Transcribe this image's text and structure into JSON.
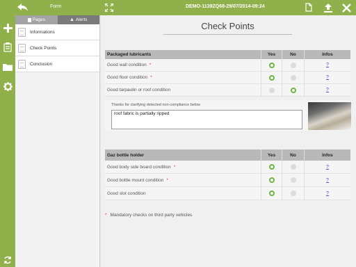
{
  "topbar": {
    "title": "Form",
    "doc_id": "DEMO-1139ZQ68-29/07/2014-09:24"
  },
  "tabs": [
    {
      "label": "Pages"
    },
    {
      "label": "Alerts"
    }
  ],
  "nav_items": [
    {
      "label": "Informations"
    },
    {
      "label": "Check Points"
    },
    {
      "label": "Conclusion"
    }
  ],
  "page_title": "Check Points",
  "columns": {
    "yes": "Yes",
    "no": "No",
    "infos": "Infos"
  },
  "sections": [
    {
      "title": "Packaged lubricants",
      "rows": [
        {
          "label": "Good wall condition",
          "mandatory": true,
          "answer": "yes",
          "info": "?"
        },
        {
          "label": "Good floor condition",
          "mandatory": true,
          "answer": "yes",
          "info": "?"
        },
        {
          "label": "Good tarpaulin or roof condition",
          "mandatory": false,
          "answer": "no",
          "info": "?"
        }
      ]
    },
    {
      "title": "Gaz bottle holder",
      "rows": [
        {
          "label": "Good body side board condition",
          "mandatory": true,
          "answer": "yes",
          "info": "?"
        },
        {
          "label": "Good bottle mount condition",
          "mandatory": true,
          "answer": "yes",
          "info": "?"
        },
        {
          "label": "Good slot condition",
          "mandatory": false,
          "answer": "yes",
          "info": "?"
        }
      ]
    }
  ],
  "comment": {
    "label": "Thanks for clarifying detected non-compliance below",
    "value": "roof fabric is partially ripped"
  },
  "mandatory_marker": "*",
  "footnote": "Mandatory checks on third party vehicles",
  "colors": {
    "accent": "#8fb04a",
    "radio_on": "#6db33f",
    "link": "#5544cc",
    "mandatory": "#dd3333"
  }
}
